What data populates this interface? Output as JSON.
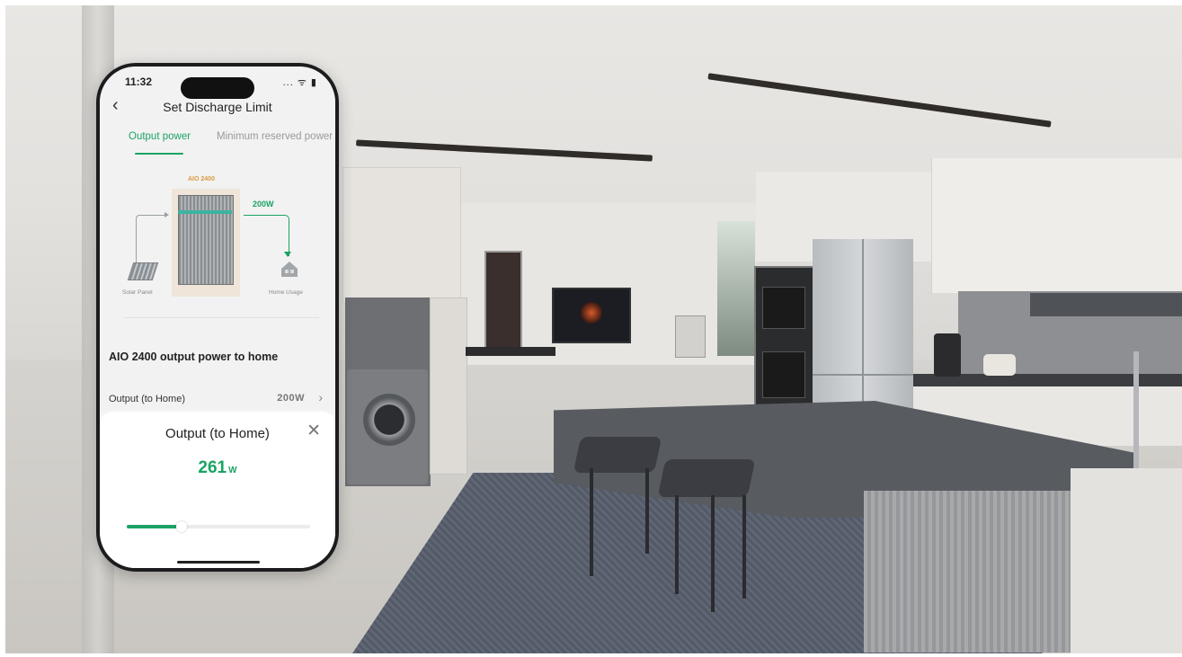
{
  "statusbar": {
    "time": "11:32",
    "icons": "... ᯤ ▮"
  },
  "nav": {
    "title": "Set Discharge Limit",
    "back_icon": "chevron-left-icon"
  },
  "tabs": [
    {
      "label": "Output power",
      "active": true
    },
    {
      "label": "Minimum reserved power",
      "active": false
    }
  ],
  "diagram": {
    "device_label": "AIO 2400",
    "power_label": "200W",
    "solar_label": "Solar Panel",
    "home_label": "Home Usage"
  },
  "settings": {
    "section_title": "AIO 2400 output power to home",
    "output_label": "Output (to Home)",
    "output_value": "200W"
  },
  "sheet": {
    "title": "Output (to Home)",
    "value": "261",
    "unit": "W",
    "slider_level_percent": 30,
    "close_icon": "close-icon"
  },
  "colors": {
    "accent": "#1aa364",
    "device_label": "#d79a3f"
  }
}
